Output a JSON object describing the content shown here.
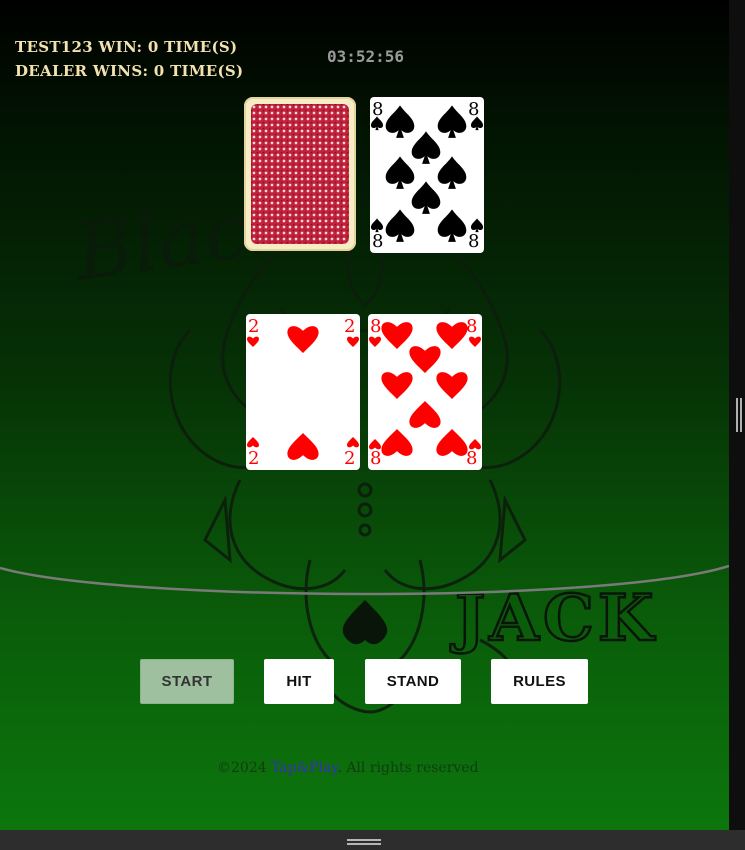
{
  "scoreboard": {
    "player": "TEST123 WIN: 0 TIME(S)",
    "dealer": "DEALER WINS: 0 TIME(S)"
  },
  "timer": "03:52:56",
  "watermark": {
    "script_text": "Black",
    "big_text": "JACK"
  },
  "dealer_hand": [
    {
      "face_down": true
    },
    {
      "rank": "8",
      "suit": "spades"
    }
  ],
  "player_hand": [
    {
      "rank": "2",
      "suit": "hearts"
    },
    {
      "rank": "8",
      "suit": "hearts"
    }
  ],
  "buttons": {
    "start": "START",
    "hit": "HIT",
    "stand": "STAND",
    "rules": "RULES"
  },
  "footer": {
    "prefix": "©2024 ",
    "brand": "Tap&Play",
    "suffix": ". All rights reserved"
  },
  "colors": {
    "felt_dark": "#000000",
    "felt_light": "#0c760c",
    "score_text": "#f3e2b0",
    "start_button_disabled": "#9ec09e",
    "heart_red": "#ff0000",
    "card_back_red": "#c0213a",
    "footer_link": "#3a2fb8"
  }
}
